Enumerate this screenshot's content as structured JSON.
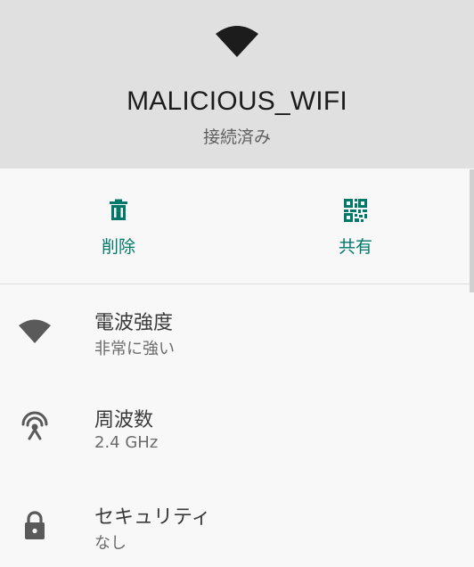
{
  "header": {
    "ssid": "MALICIOUS_WIFI",
    "status": "接続済み",
    "icon": "wifi-signal-icon"
  },
  "actions": [
    {
      "label": "削除",
      "icon": "trash-icon"
    },
    {
      "label": "共有",
      "icon": "qr-code-icon"
    }
  ],
  "details": [
    {
      "title": "電波強度",
      "value": "非常に強い",
      "icon": "wifi-signal-icon"
    },
    {
      "title": "周波数",
      "value": "2.4 GHz",
      "icon": "antenna-icon"
    },
    {
      "title": "セキュリティ",
      "value": "なし",
      "icon": "lock-icon"
    }
  ],
  "colors": {
    "accent": "#00796b",
    "header_bg": "#e0e0e0",
    "page_bg": "#f8f8f8",
    "icon_dark": "#1c1c1c",
    "icon_grey": "#5a5a5a"
  }
}
